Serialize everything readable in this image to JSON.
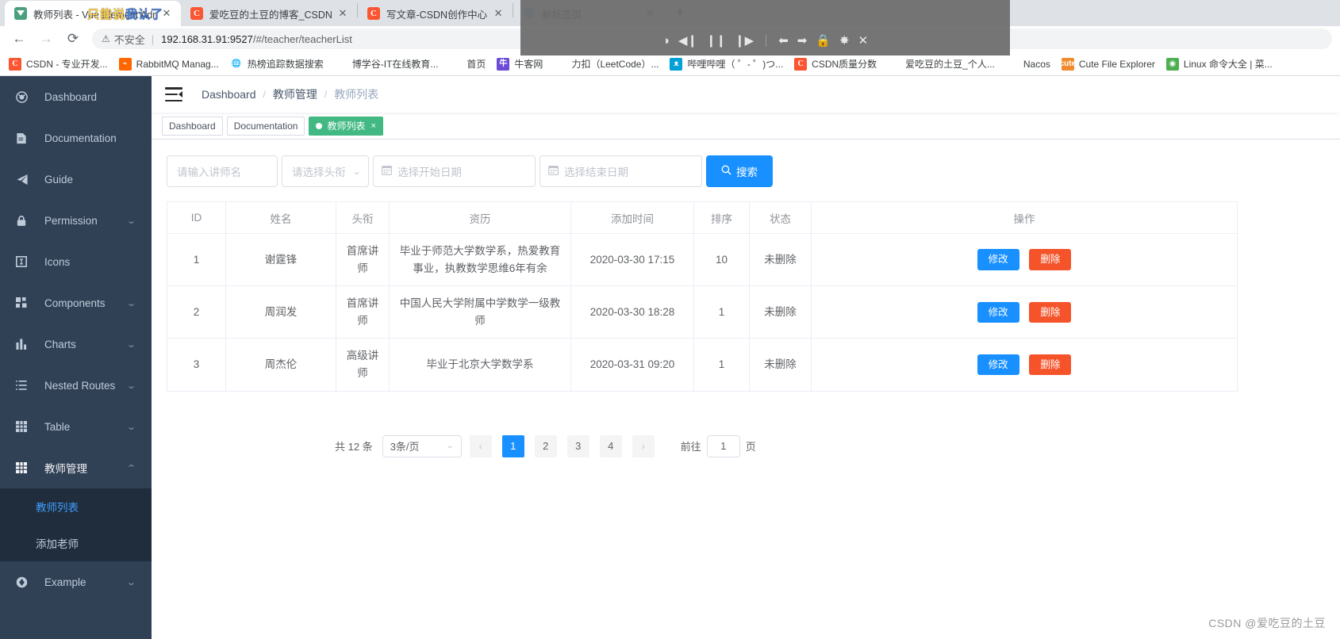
{
  "browser": {
    "tabs": [
      {
        "title": "教师列表 - Vue Element Admin",
        "favicon": "vue-icon",
        "active": true,
        "close": "✕"
      },
      {
        "title": "爱吃豆的土豆的博客_CSDN博客",
        "favicon": "csdn-icon",
        "active": false,
        "close": "✕"
      },
      {
        "title": "写文章-CSDN创作中心",
        "favicon": "csdn-icon",
        "active": false,
        "close": "✕"
      },
      {
        "title": "新标签页",
        "favicon": "globe-icon",
        "active": false,
        "close": "✕"
      }
    ],
    "new_tab_label": "+",
    "nav": {
      "back": "←",
      "forward": "→",
      "reload": "⟳"
    },
    "url": {
      "warning_icon": "⚠",
      "security_label": "不安全",
      "separator": "|",
      "host": "192.168.31.91:9527",
      "path": "/#/teacher/teacherList"
    },
    "bookmarks": [
      {
        "label": "CSDN - 专业开发...",
        "icon": "csdn-icon"
      },
      {
        "label": "RabbitMQ Manag...",
        "icon": "rabbitmq-icon"
      },
      {
        "label": "热榜追踪数据搜索",
        "icon": "globe-icon"
      },
      {
        "label": "博学谷-IT在线教育...",
        "icon": "boxuegu-icon"
      },
      {
        "label": "首页",
        "icon": "shouye-icon"
      },
      {
        "label": "牛客网",
        "icon": "nowcoder-icon"
      },
      {
        "label": "力扣（LeetCode）...",
        "icon": "leetcode-icon"
      },
      {
        "label": "哔哩哔哩（ ゜- ゜)つ...",
        "icon": "bilibili-icon"
      },
      {
        "label": "CSDN质量分数",
        "icon": "csdn-icon"
      },
      {
        "label": "爱吃豆的土豆_个人...",
        "icon": "csdn-bracket-icon"
      },
      {
        "label": "Nacos",
        "icon": "nacos-icon"
      },
      {
        "label": "Cute File Explorer",
        "icon": "cute-icon"
      },
      {
        "label": "Linux 命令大全 | 菜...",
        "icon": "linux-icon"
      }
    ],
    "overlay": {
      "note_text_1": "只能说",
      "note_text_2": "我认了",
      "controls": [
        {
          "icon": "power-icon",
          "glyph": "◑"
        },
        {
          "icon": "prev-track-icon",
          "glyph": "◀❙"
        },
        {
          "icon": "pause-icon",
          "glyph": "❙❙"
        },
        {
          "icon": "next-track-icon",
          "glyph": "❙▶"
        },
        {
          "icon": "step-back-icon",
          "glyph": "⬅"
        },
        {
          "icon": "step-forward-icon",
          "glyph": "➡"
        },
        {
          "icon": "lock-icon",
          "glyph": "🔒"
        },
        {
          "icon": "gear-icon",
          "glyph": "✸"
        },
        {
          "icon": "close-icon",
          "glyph": "✕"
        }
      ]
    }
  },
  "sidebar": {
    "items": [
      {
        "label": "Dashboard",
        "icon": "dashboard-icon",
        "glyph": "◉",
        "arrow": ""
      },
      {
        "label": "Documentation",
        "icon": "document-icon",
        "glyph": "▤",
        "arrow": ""
      },
      {
        "label": "Guide",
        "icon": "guide-paper-plane-icon",
        "glyph": "➢",
        "arrow": ""
      },
      {
        "label": "Permission",
        "icon": "lock-icon",
        "glyph": "🔒",
        "arrow": "⌄"
      },
      {
        "label": "Icons",
        "icon": "icons-icon",
        "glyph": "⊞",
        "arrow": ""
      },
      {
        "label": "Components",
        "icon": "components-icon",
        "glyph": "⊞",
        "arrow": "⌄"
      },
      {
        "label": "Charts",
        "icon": "chart-bar-icon",
        "glyph": "▥",
        "arrow": "⌄"
      },
      {
        "label": "Nested Routes",
        "icon": "nested-list-icon",
        "glyph": "☰",
        "arrow": "⌄"
      },
      {
        "label": "Table",
        "icon": "table-icon",
        "glyph": "▦",
        "arrow": "⌄"
      },
      {
        "label": "教师管理",
        "icon": "table-icon",
        "glyph": "▦",
        "arrow": "⌃",
        "open": true
      },
      {
        "label": "Example",
        "icon": "example-icon",
        "glyph": "✦",
        "arrow": "⌄"
      }
    ],
    "submenu": [
      {
        "label": "教师列表",
        "active": true
      },
      {
        "label": "添加老师",
        "active": false
      }
    ]
  },
  "navbar": {
    "hamburger": "collapse-menu-icon",
    "breadcrumb": [
      {
        "label": "Dashboard",
        "strong": true
      },
      {
        "label": "教师管理",
        "strong": true
      },
      {
        "label": "教师列表",
        "strong": false
      }
    ],
    "breadcrumb_separator": "/"
  },
  "tags_view": [
    {
      "label": "Dashboard",
      "active": false
    },
    {
      "label": "Documentation",
      "active": false
    },
    {
      "label": "教师列表",
      "active": true,
      "close": "×"
    }
  ],
  "search_form": {
    "name_placeholder": "请输入讲师名",
    "name_value": "",
    "level_placeholder": "请选择头衔",
    "level_value": "",
    "level_caret": "⌄",
    "begin_date_placeholder": "选择开始日期",
    "begin_date_value": "",
    "end_date_placeholder": "选择结束日期",
    "end_date_value": "",
    "calendar_icon": "📅",
    "search_button_label": "搜索",
    "search_icon": "🔍"
  },
  "table": {
    "columns": [
      "ID",
      "姓名",
      "头衔",
      "资历",
      "添加时间",
      "排序",
      "状态",
      "操作"
    ],
    "rows": [
      {
        "id": "1",
        "name": "谢霆锋",
        "level": "首席讲师",
        "resume": "毕业于师范大学数学系，热爱教育事业，执教数学思维6年有余",
        "gmt_create": "2020-03-30 17:15",
        "sort": "10",
        "status": "未删除"
      },
      {
        "id": "2",
        "name": "周润发",
        "level": "首席讲师",
        "resume": "中国人民大学附属中学数学一级教师",
        "gmt_create": "2020-03-30 18:28",
        "sort": "1",
        "status": "未删除"
      },
      {
        "id": "3",
        "name": "周杰伦",
        "level": "高级讲师",
        "resume": "毕业于北京大学数学系",
        "gmt_create": "2020-03-31 09:20",
        "sort": "1",
        "status": "未删除"
      }
    ],
    "edit_label": "修改",
    "delete_label": "删除"
  },
  "pagination": {
    "total_label": "共 12 条",
    "page_size_value": "3条/页",
    "page_size_caret": "⌄",
    "prev_arrow": "‹",
    "next_arrow": "›",
    "pages": [
      "1",
      "2",
      "3",
      "4"
    ],
    "current_page": "1",
    "jump_prefix": "前往",
    "jump_value": "1",
    "jump_suffix": "页"
  },
  "watermark": "CSDN @爱吃豆的土豆",
  "colors": {
    "primary": "#1890ff",
    "danger": "#f5542b",
    "tag_active": "#42b983",
    "sidebar_bg": "#304156",
    "submenu_bg": "#1f2d3d",
    "sidebar_text": "#bfcbd9",
    "link_active": "#409eff"
  }
}
